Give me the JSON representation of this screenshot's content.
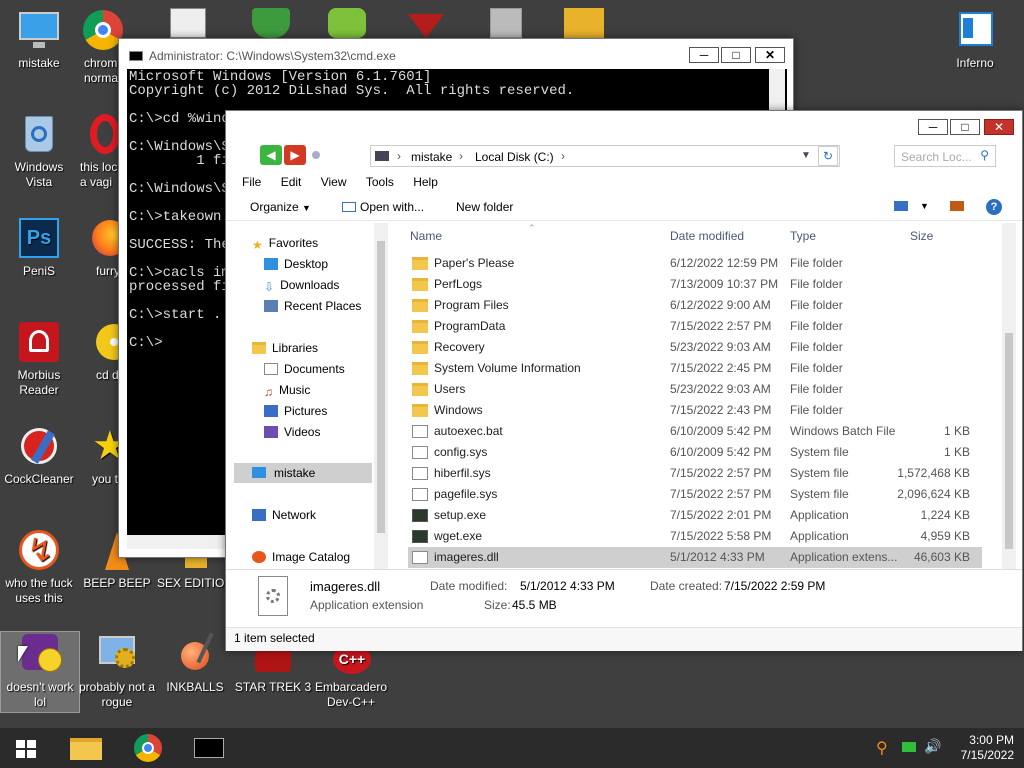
{
  "desktop": {
    "icons": [
      {
        "label": "mistake"
      },
      {
        "label": "chrom normal"
      },
      {
        "label": "Windows Vista"
      },
      {
        "label": "this loc a vagi"
      },
      {
        "label": "PeniS"
      },
      {
        "label": "furry"
      },
      {
        "label": "Morbius Reader"
      },
      {
        "label": "cd d"
      },
      {
        "label": "CockCleaner"
      },
      {
        "label": "you t"
      },
      {
        "label": "who the fuck uses this"
      },
      {
        "label": "BEEP BEEP"
      },
      {
        "label": "SEX EDITIOR"
      },
      {
        "label": "doesn't work lol"
      },
      {
        "label": "probably not a rogue"
      },
      {
        "label": "INKBALLS"
      },
      {
        "label": "STAR TREK 3"
      },
      {
        "label": "Embarcadero Dev-C++"
      },
      {
        "label": "Inferno"
      }
    ]
  },
  "cmd": {
    "title": "Administrator: C:\\Windows\\System32\\cmd.exe",
    "lines": [
      "Microsoft Windows [Version 6.1.7601]",
      "Copyright (c) 2012 DiLshad Sys.  All rights reserved.",
      "",
      "C:\\>cd %wind",
      "",
      "C:\\Windows\\S",
      "        1 fi",
      "",
      "C:\\Windows\\S",
      "",
      "C:\\>takeown",
      "",
      "SUCCESS: The",
      "",
      "C:\\>cacls im",
      "processed fi",
      "",
      "C:\\>start .",
      "",
      "C:\\>"
    ]
  },
  "explorer": {
    "breadcrumb": [
      "mistake",
      "Local Disk (C:)"
    ],
    "search_placeholder": "Search Loc...",
    "menu": [
      "File",
      "Edit",
      "View",
      "Tools",
      "Help"
    ],
    "toolbar": {
      "organize": "Organize",
      "open_with": "Open with...",
      "new_folder": "New folder"
    },
    "nav": {
      "favorites": "Favorites",
      "favorites_items": [
        "Desktop",
        "Downloads",
        "Recent Places"
      ],
      "libraries": "Libraries",
      "libraries_items": [
        "Documents",
        "Music",
        "Pictures",
        "Videos"
      ],
      "computer": "mistake",
      "network": "Network",
      "image_catalog": "Image Catalog"
    },
    "columns": {
      "name": "Name",
      "date": "Date modified",
      "type": "Type",
      "size": "Size"
    },
    "files": [
      {
        "name": "Paper's Please",
        "date": "6/12/2022 12:59 PM",
        "type": "File folder",
        "size": "",
        "icon": "folder"
      },
      {
        "name": "PerfLogs",
        "date": "7/13/2009 10:37 PM",
        "type": "File folder",
        "size": "",
        "icon": "folder"
      },
      {
        "name": "Program Files",
        "date": "6/12/2022 9:00 AM",
        "type": "File folder",
        "size": "",
        "icon": "folder"
      },
      {
        "name": "ProgramData",
        "date": "7/15/2022 2:57 PM",
        "type": "File folder",
        "size": "",
        "icon": "folder"
      },
      {
        "name": "Recovery",
        "date": "5/23/2022 9:03 AM",
        "type": "File folder",
        "size": "",
        "icon": "locked-folder"
      },
      {
        "name": "System Volume Information",
        "date": "7/15/2022 2:45 PM",
        "type": "File folder",
        "size": "",
        "icon": "locked-folder"
      },
      {
        "name": "Users",
        "date": "5/23/2022 9:03 AM",
        "type": "File folder",
        "size": "",
        "icon": "folder"
      },
      {
        "name": "Windows",
        "date": "7/15/2022 2:43 PM",
        "type": "File folder",
        "size": "",
        "icon": "folder"
      },
      {
        "name": "autoexec.bat",
        "date": "6/10/2009 5:42 PM",
        "type": "Windows Batch File",
        "size": "1 KB",
        "icon": "file"
      },
      {
        "name": "config.sys",
        "date": "6/10/2009 5:42 PM",
        "type": "System file",
        "size": "1 KB",
        "icon": "file"
      },
      {
        "name": "hiberfil.sys",
        "date": "7/15/2022 2:57 PM",
        "type": "System file",
        "size": "1,572,468 KB",
        "icon": "file"
      },
      {
        "name": "pagefile.sys",
        "date": "7/15/2022 2:57 PM",
        "type": "System file",
        "size": "2,096,624 KB",
        "icon": "file"
      },
      {
        "name": "setup.exe",
        "date": "7/15/2022 2:01 PM",
        "type": "Application",
        "size": "1,224 KB",
        "icon": "app"
      },
      {
        "name": "wget.exe",
        "date": "7/15/2022 5:58 PM",
        "type": "Application",
        "size": "4,959 KB",
        "icon": "app"
      },
      {
        "name": "imageres.dll",
        "date": "5/1/2012 4:33 PM",
        "type": "Application extens...",
        "size": "46,603 KB",
        "icon": "file",
        "selected": true
      }
    ],
    "details": {
      "name": "imageres.dll",
      "kind": "Application extension",
      "modified_label": "Date modified:",
      "modified": "5/1/2012 4:33 PM",
      "created_label": "Date created:",
      "created": "7/15/2022 2:59 PM",
      "size_label": "Size:",
      "size": "45.5 MB"
    },
    "status": "1 item selected"
  },
  "clock": {
    "time": "3:00 PM",
    "date": "7/15/2022"
  }
}
